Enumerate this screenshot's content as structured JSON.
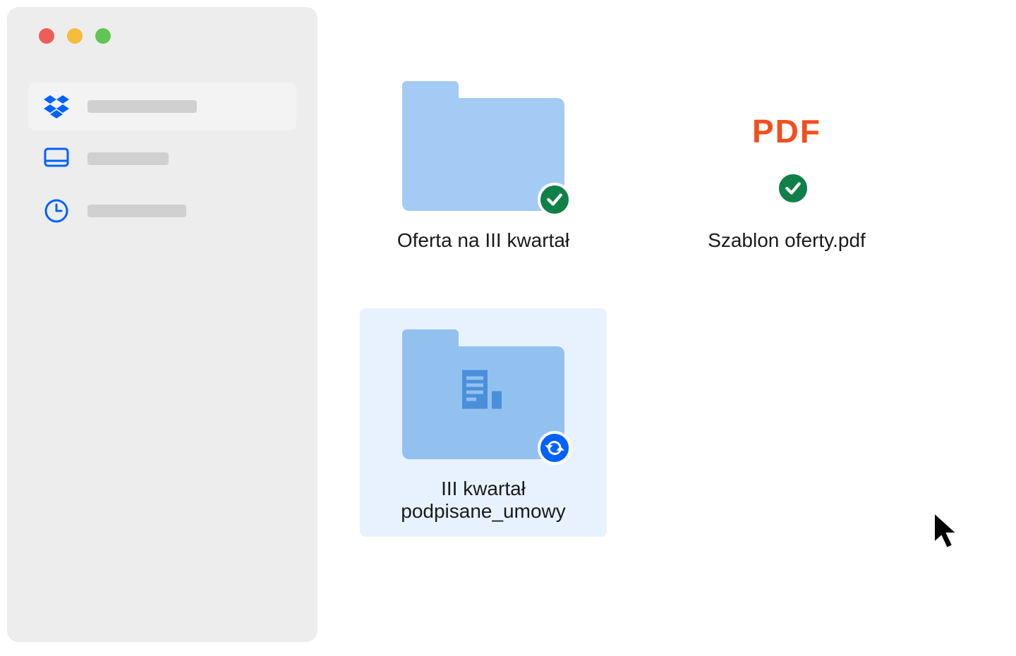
{
  "sidebar": {
    "items": [
      {
        "icon": "dropbox-icon",
        "active": true
      },
      {
        "icon": "desktop-icon",
        "active": false
      },
      {
        "icon": "clock-icon",
        "active": false
      }
    ]
  },
  "main": {
    "items": [
      {
        "type": "folder",
        "label": "Oferta na III kwartał",
        "status": "synced",
        "selected": false
      },
      {
        "type": "pdf",
        "label": "Szablon oferty.pdf",
        "badge_text": "PDF",
        "status": "synced",
        "selected": false
      },
      {
        "type": "folder-docs",
        "label": "III kwartał podpisane_umowy",
        "status": "syncing",
        "selected": true
      }
    ]
  }
}
